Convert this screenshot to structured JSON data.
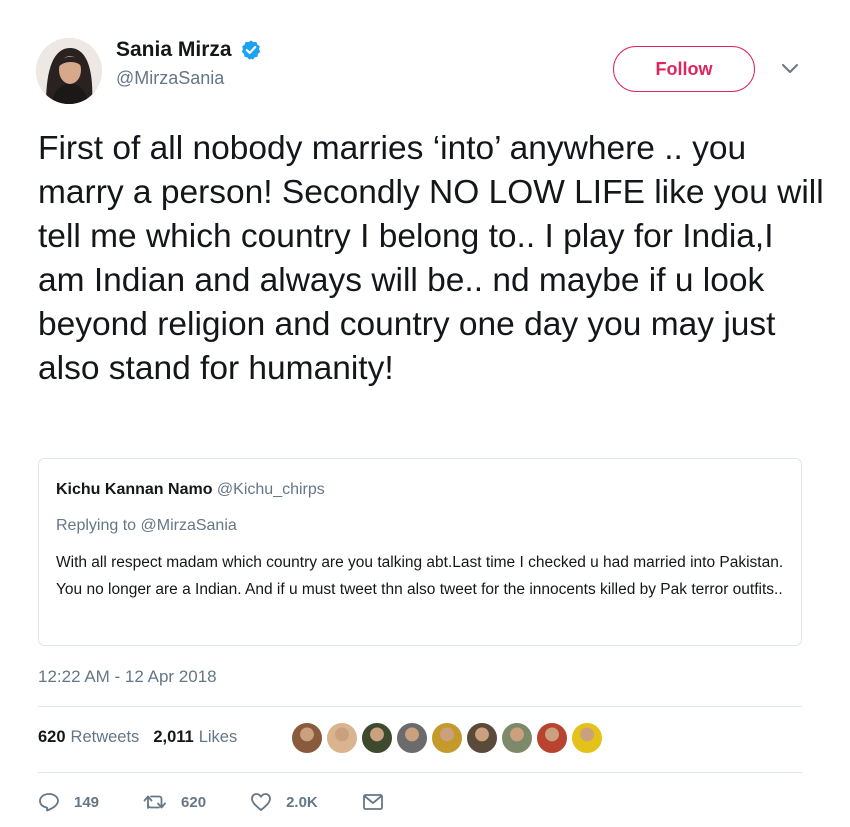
{
  "author": {
    "display_name": "Sania Mirza",
    "handle": "@MirzaSania",
    "verified": true,
    "avatar_icon": "profile-photo"
  },
  "follow_button": {
    "label": "Follow",
    "color": "#e0245e"
  },
  "more_menu_icon": "chevron-down-icon",
  "tweet": {
    "text": "First of all nobody marries ‘into’ anywhere .. you marry a person! Secondly NO LOW LIFE like you will tell me which country I belong to.. I play for India,I am Indian and always will be.. nd maybe if u look beyond religion and country one day you may just also stand for humanity!"
  },
  "quoted_tweet": {
    "display_name": "Kichu Kannan Namo",
    "handle": "@Kichu_chirps",
    "replying_to_prefix": "Replying to",
    "replying_to_handle": "@MirzaSania",
    "text": "With all respect madam which country are you talking abt.Last time I checked u had married into Pakistan. You no longer are a Indian. And if u must tweet thn also tweet for the innocents killed by Pak terror outfits.."
  },
  "timestamp": "12:22 AM - 12 Apr 2018",
  "stats": {
    "retweets_count": "620",
    "retweets_label": "Retweets",
    "likes_count": "2,011",
    "likes_label": "Likes"
  },
  "likers_avatars": [
    {
      "name": "liker-avatar-1",
      "color": "#8a5a3c"
    },
    {
      "name": "liker-avatar-2",
      "color": "#d9b48f"
    },
    {
      "name": "liker-avatar-3",
      "color": "#3d4a2e"
    },
    {
      "name": "liker-avatar-4",
      "color": "#6b6b6b"
    },
    {
      "name": "liker-avatar-5",
      "color": "#c49a2c"
    },
    {
      "name": "liker-avatar-6",
      "color": "#5a4a3a"
    },
    {
      "name": "liker-avatar-7",
      "color": "#7d8a6a"
    },
    {
      "name": "liker-avatar-8",
      "color": "#b8432f"
    },
    {
      "name": "liker-avatar-9",
      "color": "#e3c21a"
    }
  ],
  "actions": {
    "reply_count": "149",
    "retweet_count": "620",
    "like_count": "2.0K"
  },
  "colors": {
    "text": "#14171a",
    "secondary": "#657786",
    "border": "#e1e8ed",
    "verified": "#1da1f2",
    "follow": "#e0245e"
  }
}
